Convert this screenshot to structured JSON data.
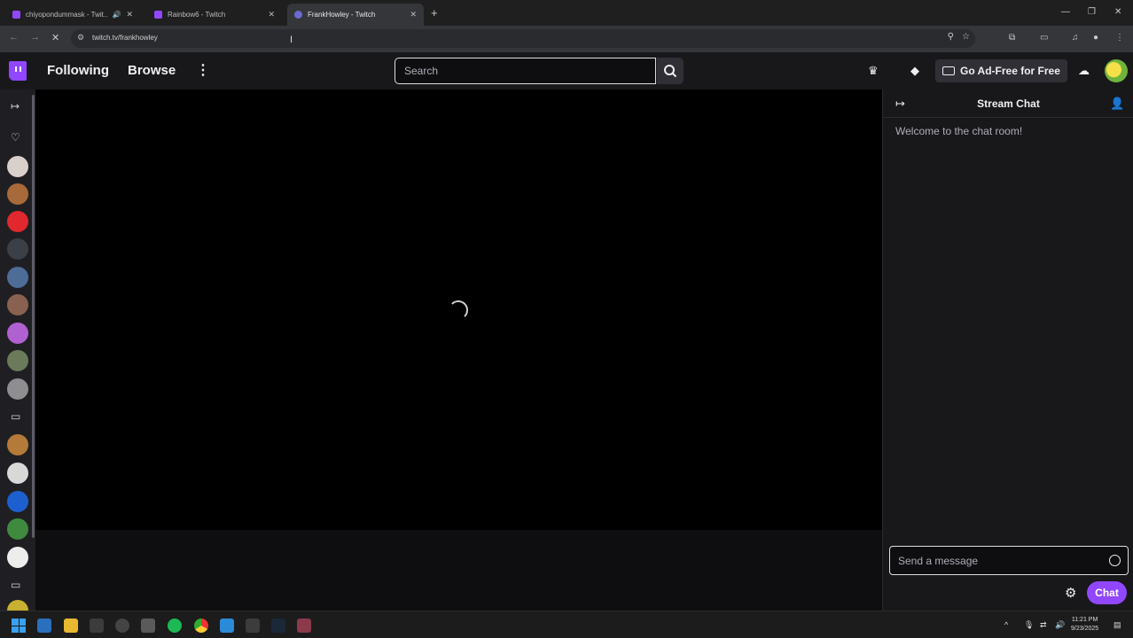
{
  "browser": {
    "tabs": [
      {
        "title": "chiyopondummask - Twit..."
      },
      {
        "title": "Rainbow6 - Twitch"
      },
      {
        "title": "FrankHowley - Twitch"
      }
    ],
    "new_tab": "+",
    "url": "twitch.tv/frankhowley"
  },
  "nav": {
    "following": "Following",
    "browse": "Browse",
    "more": "⋮",
    "search_placeholder": "Search",
    "ad_free": "Go Ad-Free for Free"
  },
  "chat": {
    "title": "Stream Chat",
    "welcome": "Welcome to the chat room!",
    "input_placeholder": "Send a message",
    "send_button": "Chat"
  },
  "taskbar": {
    "time": "11:21 PM",
    "date": "9/23/2025"
  },
  "colors": {
    "brand": "#9147ff",
    "background": "#0e0e10",
    "surface": "#18181b"
  },
  "icons": [
    "twitch-logo-icon",
    "search-icon",
    "crown-icon",
    "drop-icon",
    "tv-icon",
    "cloud-icon",
    "collapse-icon",
    "heart-icon",
    "camera-icon",
    "users-icon",
    "gear-icon",
    "emote-icon"
  ]
}
